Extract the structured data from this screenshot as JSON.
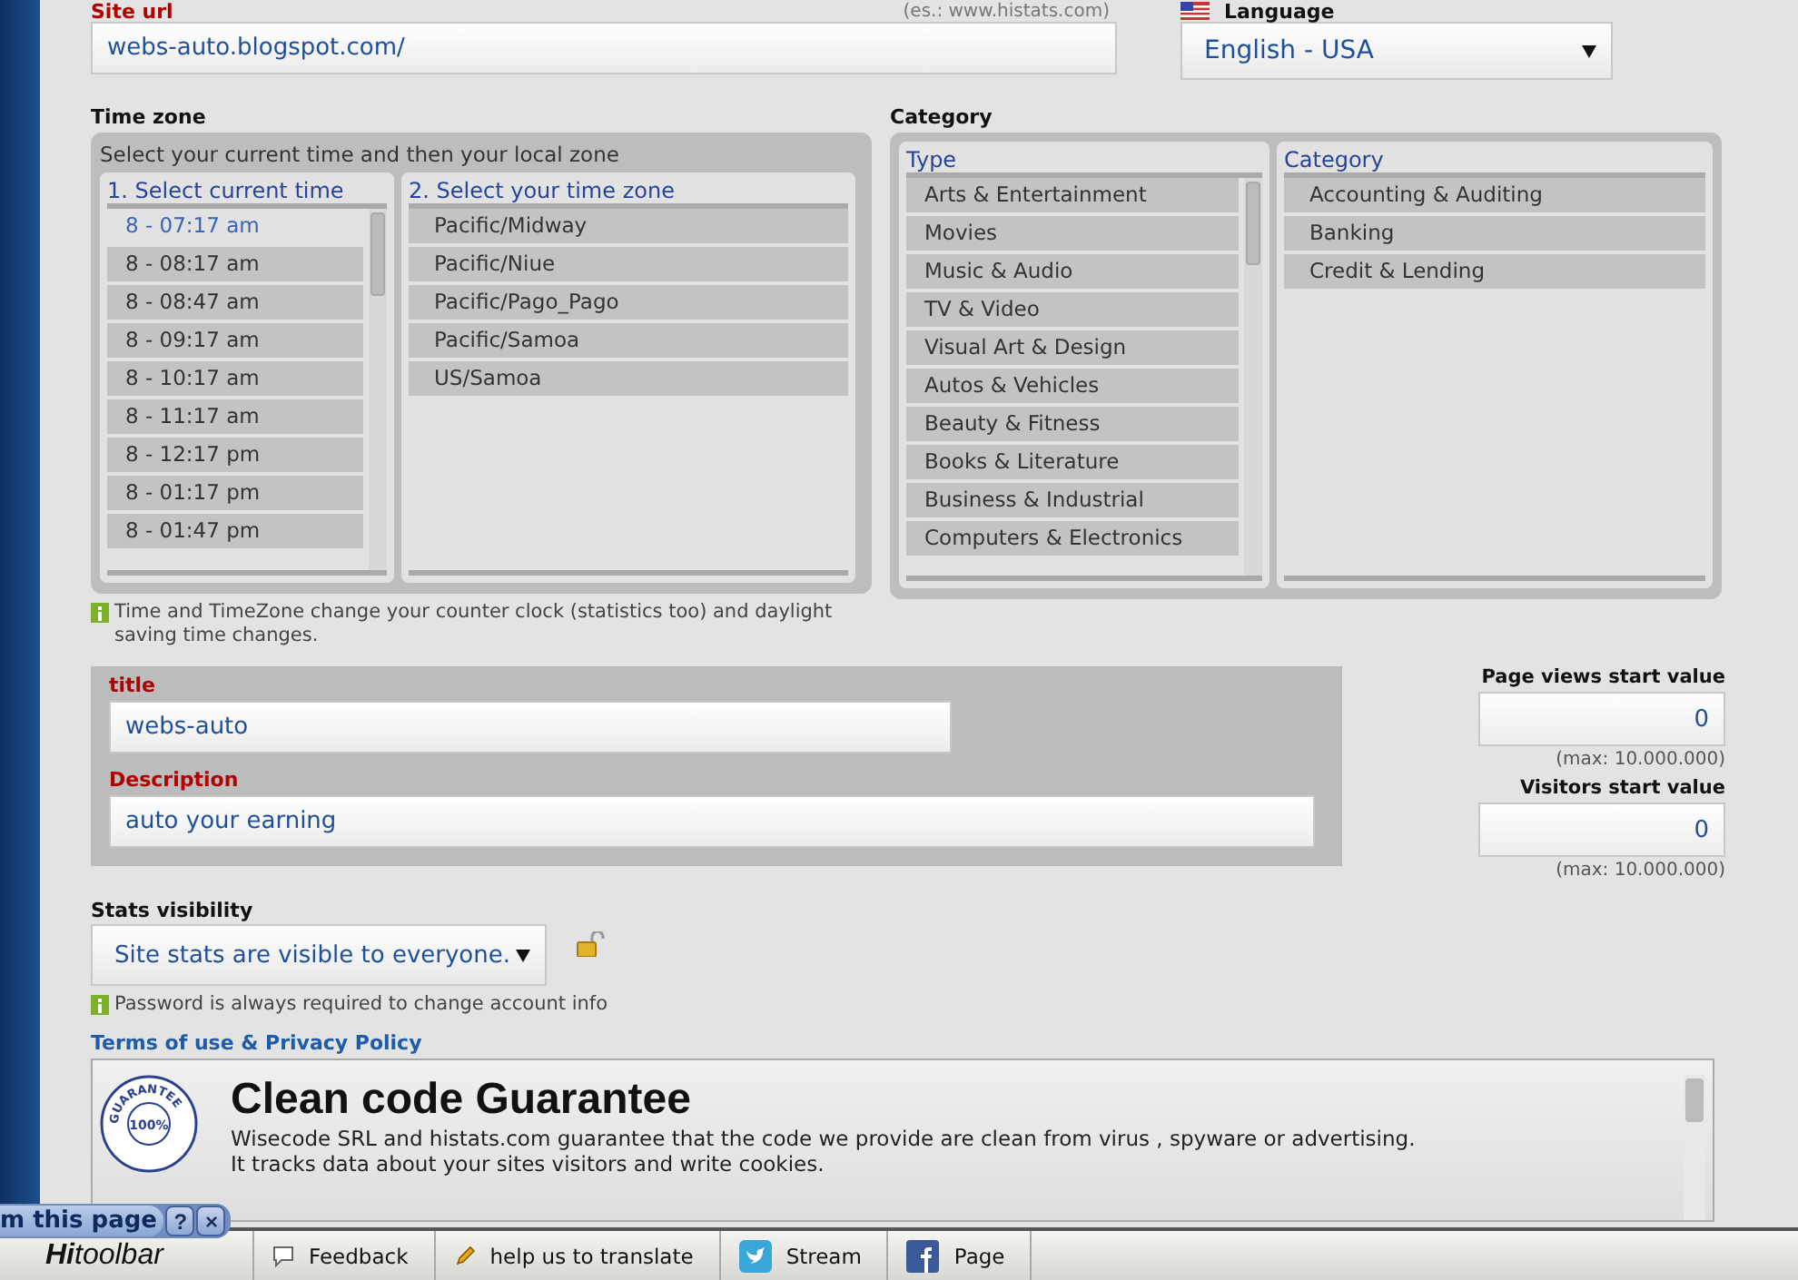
{
  "site_url": {
    "label": "Site url",
    "hint": "(es.: www.histats.com)",
    "value": "webs-auto.blogspot.com/"
  },
  "language": {
    "label": "Language",
    "value": "English - USA"
  },
  "time_zone": {
    "title": "Time zone",
    "instruction": "Select your current time and then your local zone",
    "time_list": {
      "heading": "1. Select current time",
      "items": [
        {
          "label": "8 - 07:17 am",
          "selected": true
        },
        {
          "label": "8 - 08:17 am",
          "selected": false
        },
        {
          "label": "8 - 08:47 am",
          "selected": false
        },
        {
          "label": "8 - 09:17 am",
          "selected": false
        },
        {
          "label": "8 - 10:17 am",
          "selected": false
        },
        {
          "label": "8 - 11:17 am",
          "selected": false
        },
        {
          "label": "8 - 12:17 pm",
          "selected": false
        },
        {
          "label": "8 - 01:17 pm",
          "selected": false
        },
        {
          "label": "8 - 01:47 pm",
          "selected": false
        }
      ]
    },
    "zone_list": {
      "heading": "2. Select your time zone",
      "items": [
        {
          "label": "Pacific/Midway",
          "selected": false
        },
        {
          "label": "Pacific/Niue",
          "selected": false
        },
        {
          "label": "Pacific/Pago_Pago",
          "selected": false
        },
        {
          "label": "Pacific/Samoa",
          "selected": false
        },
        {
          "label": "US/Samoa",
          "selected": false
        }
      ]
    }
  },
  "category": {
    "title": "Category",
    "type_list": {
      "heading": "Type",
      "items": [
        {
          "label": "Arts & Entertainment",
          "selected": false
        },
        {
          "label": "Movies",
          "selected": false
        },
        {
          "label": "Music & Audio",
          "selected": false
        },
        {
          "label": "TV & Video",
          "selected": false
        },
        {
          "label": "Visual Art & Design",
          "selected": false
        },
        {
          "label": "Autos & Vehicles",
          "selected": false
        },
        {
          "label": "Beauty & Fitness",
          "selected": false
        },
        {
          "label": "Books & Literature",
          "selected": false
        },
        {
          "label": "Business & Industrial",
          "selected": false
        },
        {
          "label": "Computers & Electronics",
          "selected": false
        }
      ]
    },
    "category_list": {
      "heading": "Category",
      "items": [
        {
          "label": "Accounting & Auditing",
          "selected": false
        },
        {
          "label": "Banking",
          "selected": false
        },
        {
          "label": "Credit & Lending",
          "selected": false
        }
      ]
    }
  },
  "timezone_note": "Time and TimeZone change your counter clock (statistics too) and daylight saving time changes.",
  "title_field": {
    "label": "title",
    "value": "webs-auto"
  },
  "description_field": {
    "label": "Description",
    "value": "auto your earning"
  },
  "counters": [
    {
      "label": "Page views start value",
      "value": "0",
      "max": "(max: 10.000.000)"
    },
    {
      "label": "Visitors start value",
      "value": "0",
      "max": "(max: 10.000.000)"
    }
  ],
  "stats_visibility": {
    "label": "Stats visibility",
    "value": "Site stats are visible to everyone."
  },
  "password_note": "Password is always required to change account info",
  "terms": {
    "link": "Terms of use & Privacy Policy",
    "seal_ring": "GUARANTEE",
    "seal_center": "100%",
    "heading": "Clean code Guarantee",
    "lines": [
      "Wisecode SRL and histats.com guarantee that the code we provide are clean from virus , spyware or advertising.",
      "It tracks data about your sites visitors and write cookies."
    ]
  },
  "floating_bar": {
    "label": "m this page",
    "help": "?",
    "close": "×"
  },
  "toolbar": {
    "brand": "**Hi**toolbar",
    "items": [
      {
        "kind": "feedback",
        "label": "Feedback"
      },
      {
        "kind": "translate",
        "label": "help us to translate"
      },
      {
        "kind": "stream",
        "label": "Stream"
      },
      {
        "kind": "page",
        "label": "Page"
      }
    ]
  }
}
